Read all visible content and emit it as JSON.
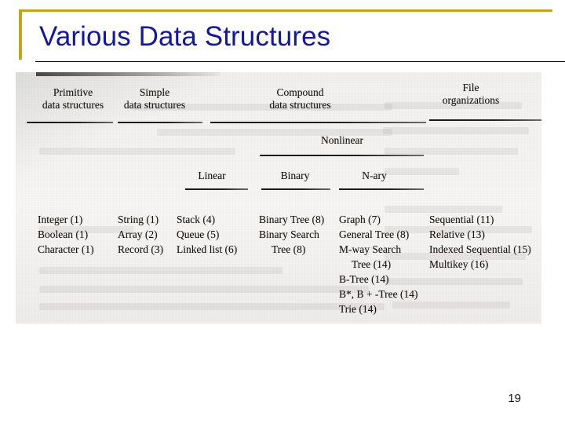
{
  "slide": {
    "title": "Various Data Structures",
    "page_number": "19",
    "accent_color": "#c8a415",
    "title_color": "#13189c"
  },
  "figure": {
    "type": "hierarchy-table",
    "level1": [
      {
        "name": "primitive",
        "line1": "Primitive",
        "line2": "data structures"
      },
      {
        "name": "simple",
        "line1": "Simple",
        "line2": "data structures"
      },
      {
        "name": "compound",
        "line1": "Compound",
        "line2": "data structures"
      },
      {
        "name": "file-organizations",
        "line1": "File",
        "line2": "organizations"
      }
    ],
    "level2": [
      {
        "name": "nonlinear",
        "label": "Nonlinear"
      }
    ],
    "level3": [
      {
        "name": "linear",
        "label": "Linear"
      },
      {
        "name": "binary",
        "label": "Binary"
      },
      {
        "name": "nary",
        "label": "N-ary"
      }
    ],
    "columns": [
      {
        "name": "primitive-items",
        "items": [
          {
            "text": "Integer (1)",
            "indent": false
          },
          {
            "text": "Boolean (1)",
            "indent": false
          },
          {
            "text": "Character (1)",
            "indent": false
          }
        ]
      },
      {
        "name": "simple-items",
        "items": [
          {
            "text": "String (1)",
            "indent": false
          },
          {
            "text": "Array (2)",
            "indent": false
          },
          {
            "text": "Record (3)",
            "indent": false
          }
        ]
      },
      {
        "name": "linear-items",
        "items": [
          {
            "text": "Stack (4)",
            "indent": false
          },
          {
            "text": "Queue (5)",
            "indent": false
          },
          {
            "text": "Linked list (6)",
            "indent": false
          }
        ]
      },
      {
        "name": "binary-items",
        "items": [
          {
            "text": "Binary Tree (8)",
            "indent": false
          },
          {
            "text": "Binary Search",
            "indent": false
          },
          {
            "text": "Tree (8)",
            "indent": true
          }
        ]
      },
      {
        "name": "nary-items",
        "items": [
          {
            "text": "Graph (7)",
            "indent": false
          },
          {
            "text": "General Tree (8)",
            "indent": false
          },
          {
            "text": "M-way Search",
            "indent": false
          },
          {
            "text": "Tree (14)",
            "indent": true
          },
          {
            "text": "B-Tree (14)",
            "indent": false
          },
          {
            "text": "B*, B + -Tree (14)",
            "indent": false
          },
          {
            "text": "Trie (14)",
            "indent": false
          }
        ]
      },
      {
        "name": "file-organization-items",
        "items": [
          {
            "text": "Sequential (11)",
            "indent": false
          },
          {
            "text": "Relative (13)",
            "indent": false
          },
          {
            "text": "Indexed Sequential (15)",
            "indent": false
          },
          {
            "text": "Multikey (16)",
            "indent": false
          }
        ]
      }
    ]
  }
}
